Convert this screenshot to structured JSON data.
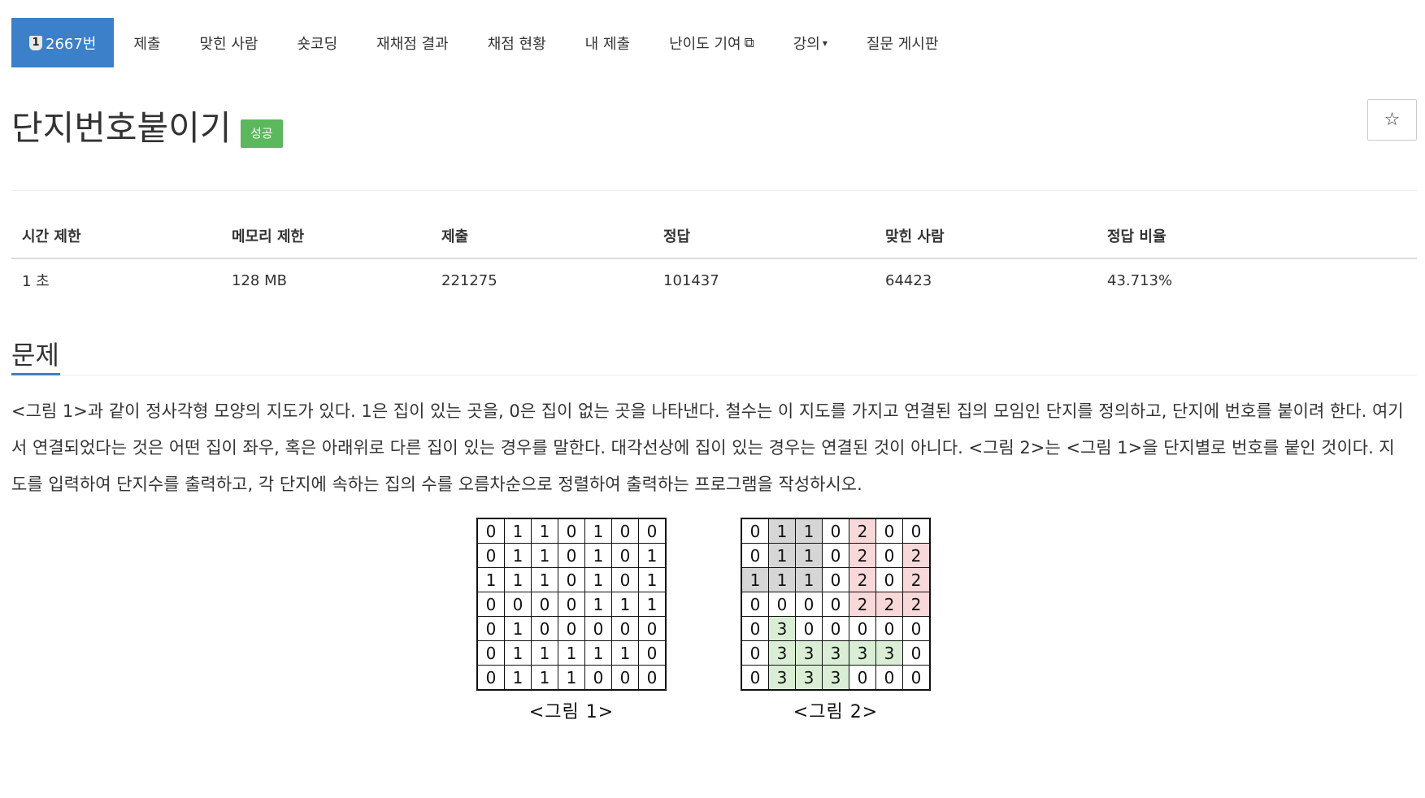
{
  "nav": {
    "problem_badge": "1",
    "problem_number": "2667번",
    "tabs": [
      "제출",
      "맞힌 사람",
      "숏코딩",
      "재채점 결과",
      "채점 현황",
      "내 제출"
    ],
    "difficulty_label": "난이도 기여",
    "lecture_label": "강의",
    "board_label": "질문 게시판"
  },
  "problem": {
    "title": "단지번호붙이기",
    "status_badge": "성공",
    "star_symbol": "☆"
  },
  "info_table": {
    "headers": [
      "시간 제한",
      "메모리 제한",
      "제출",
      "정답",
      "맞힌 사람",
      "정답 비율"
    ],
    "values": [
      "1 초",
      "128 MB",
      "221275",
      "101437",
      "64423",
      "43.713%"
    ]
  },
  "section": {
    "title": "문제",
    "text": "<그림 1>과 같이 정사각형 모양의 지도가 있다. 1은 집이 있는 곳을, 0은 집이 없는 곳을 나타낸다. 철수는 이 지도를 가지고 연결된 집의 모임인 단지를 정의하고, 단지에 번호를 붙이려 한다. 여기서 연결되었다는 것은 어떤 집이 좌우, 혹은 아래위로 다른 집이 있는 경우를 말한다. 대각선상에 집이 있는 경우는 연결된 것이 아니다. <그림 2>는 <그림 1>을 단지별로 번호를 붙인 것이다. 지도를 입력하여 단지수를 출력하고, 각 단지에 속하는 집의 수를 오름차순으로 정렬하여 출력하는 프로그램을 작성하시오."
  },
  "figure1": {
    "caption": "<그림 1>",
    "grid": [
      [
        0,
        1,
        1,
        0,
        1,
        0,
        0
      ],
      [
        0,
        1,
        1,
        0,
        1,
        0,
        1
      ],
      [
        1,
        1,
        1,
        0,
        1,
        0,
        1
      ],
      [
        0,
        0,
        0,
        0,
        1,
        1,
        1
      ],
      [
        0,
        1,
        0,
        0,
        0,
        0,
        0
      ],
      [
        0,
        1,
        1,
        1,
        1,
        1,
        0
      ],
      [
        0,
        1,
        1,
        1,
        0,
        0,
        0
      ]
    ]
  },
  "figure2": {
    "caption": "<그림 2>",
    "grid": [
      [
        0,
        1,
        1,
        0,
        2,
        0,
        0
      ],
      [
        0,
        1,
        1,
        0,
        2,
        0,
        2
      ],
      [
        1,
        1,
        1,
        0,
        2,
        0,
        2
      ],
      [
        0,
        0,
        0,
        0,
        2,
        2,
        2
      ],
      [
        0,
        3,
        0,
        0,
        0,
        0,
        0
      ],
      [
        0,
        3,
        3,
        3,
        3,
        3,
        0
      ],
      [
        0,
        3,
        3,
        3,
        0,
        0,
        0
      ]
    ],
    "colors": {
      "1": "#d6d6d6",
      "2": "#f8d8d8",
      "3": "#d9eed4"
    }
  }
}
